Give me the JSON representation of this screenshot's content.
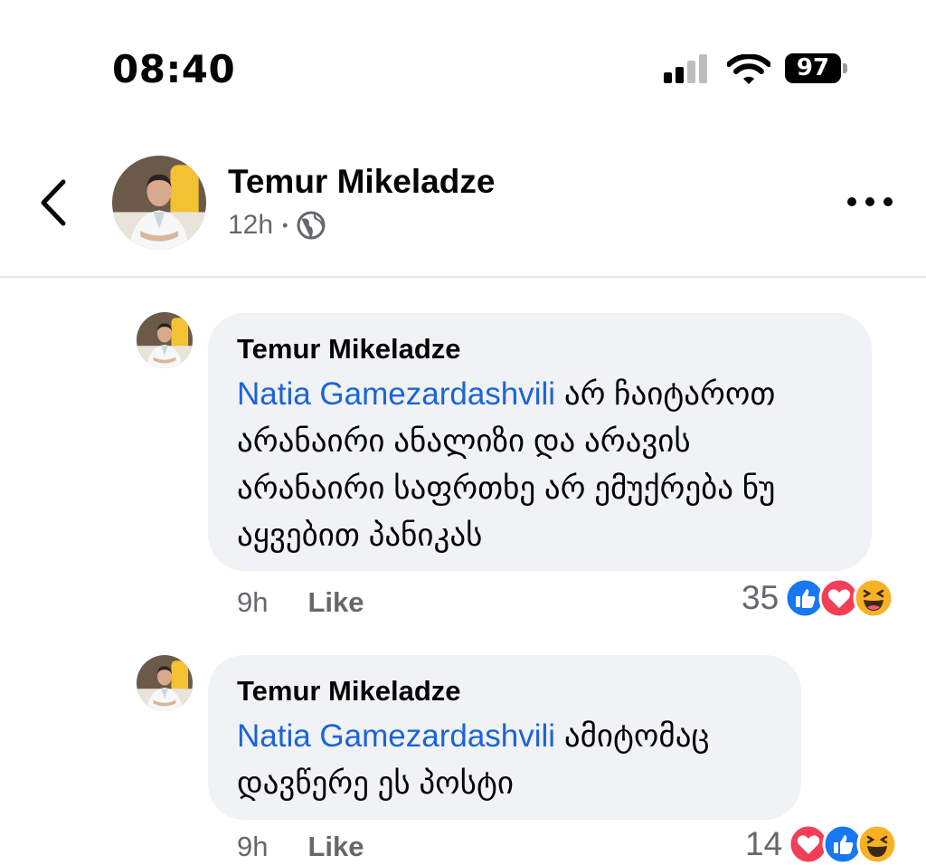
{
  "status_bar": {
    "time": "08:40",
    "battery": "97"
  },
  "post_header": {
    "author": "Temur Mikeladze",
    "time": "12h"
  },
  "comments": [
    {
      "author": "Temur Mikeladze",
      "mention": "Natia Gamezardashvili",
      "text_line1": " არ ჩაიტაროთ",
      "text_line2": "არანაირი ანალიზი  და არავის",
      "text_line3": "არანაირი საფრთხე არ ემუქრება ნუ",
      "text_line4": "აყვებით პანიკას",
      "time": "9h",
      "like_label": "Like",
      "reaction_count": "35",
      "reactions": [
        "like-icon",
        "love-icon",
        "haha-icon"
      ]
    },
    {
      "author": "Temur Mikeladze",
      "mention": "Natia Gamezardashvili",
      "text_line1": " ამიტომაც",
      "text_line2": "დავწერე ეს პოსტი",
      "time": "9h",
      "like_label": "Like",
      "reaction_count": "14",
      "reactions": [
        "love-icon",
        "like-icon",
        "haha-icon"
      ]
    }
  ],
  "colors": {
    "mention": "#1b64d9",
    "bubble": "#f0f2f5",
    "meta": "#65676b",
    "like": "#1877f2",
    "love": "#f33e58",
    "haha": "#f7b125"
  }
}
